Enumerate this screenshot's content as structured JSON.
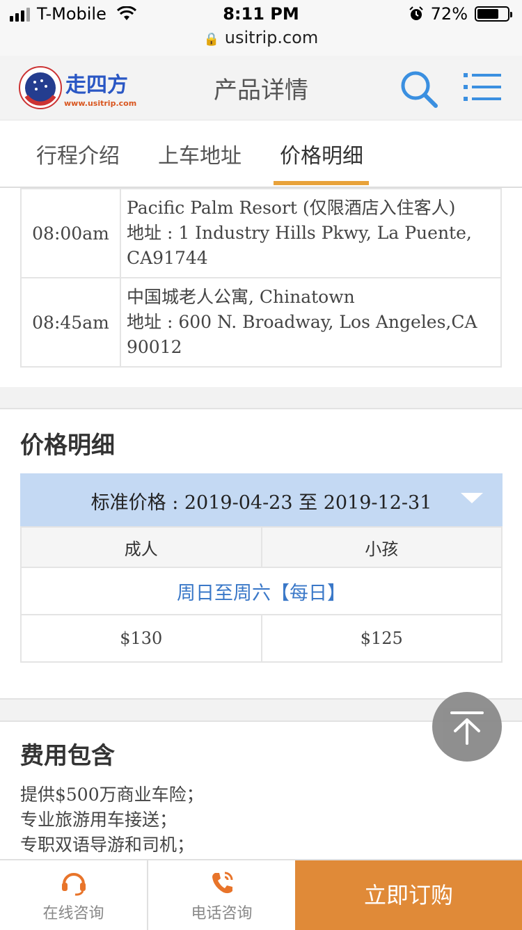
{
  "status_bar": {
    "carrier": "T-Mobile",
    "time": "8:11 PM",
    "battery": "72%",
    "battery_level": 0.72,
    "url": "usitrip.com"
  },
  "header": {
    "title": "产品详情",
    "logo_text": "www.usitrip.com"
  },
  "tabs": [
    {
      "label": "行程介绍"
    },
    {
      "label": "上车地址"
    },
    {
      "label": "价格明细"
    }
  ],
  "active_tab": 2,
  "pickup": [
    {
      "time": "08:00am",
      "place": "Pacific Palm Resort (仅限酒店入住客人)",
      "address": "地址 : 1 Industry Hills Pkwy, La Puente, CA91744"
    },
    {
      "time": "08:45am",
      "place": "中国城老人公寓, Chinatown",
      "address": "地址 : 600 N. Broadway, Los Angeles,CA 90012"
    }
  ],
  "price": {
    "section_title": "价格明细",
    "period_label": "标准价格 : 2019-04-23 至 2019-12-31",
    "headers": [
      "成人",
      "小孩"
    ],
    "day_label": "周日至周六【每日】",
    "values": [
      "$130",
      "$125"
    ]
  },
  "includes": {
    "title": "费用包含",
    "items": [
      "提供$500万商业车险；",
      "专业旅游用车接送；",
      "专职双语导游和司机；"
    ]
  },
  "bottom_bar": {
    "online": "在线咨询",
    "phone": "电话咨询",
    "buy": "立即订购"
  },
  "colors": {
    "accent": "#e08a38",
    "tab_underline": "#e8a23a",
    "price_header_bg": "#c4d9f3",
    "link_blue": "#3a78c8",
    "icon_blue": "#3a8fe0"
  }
}
